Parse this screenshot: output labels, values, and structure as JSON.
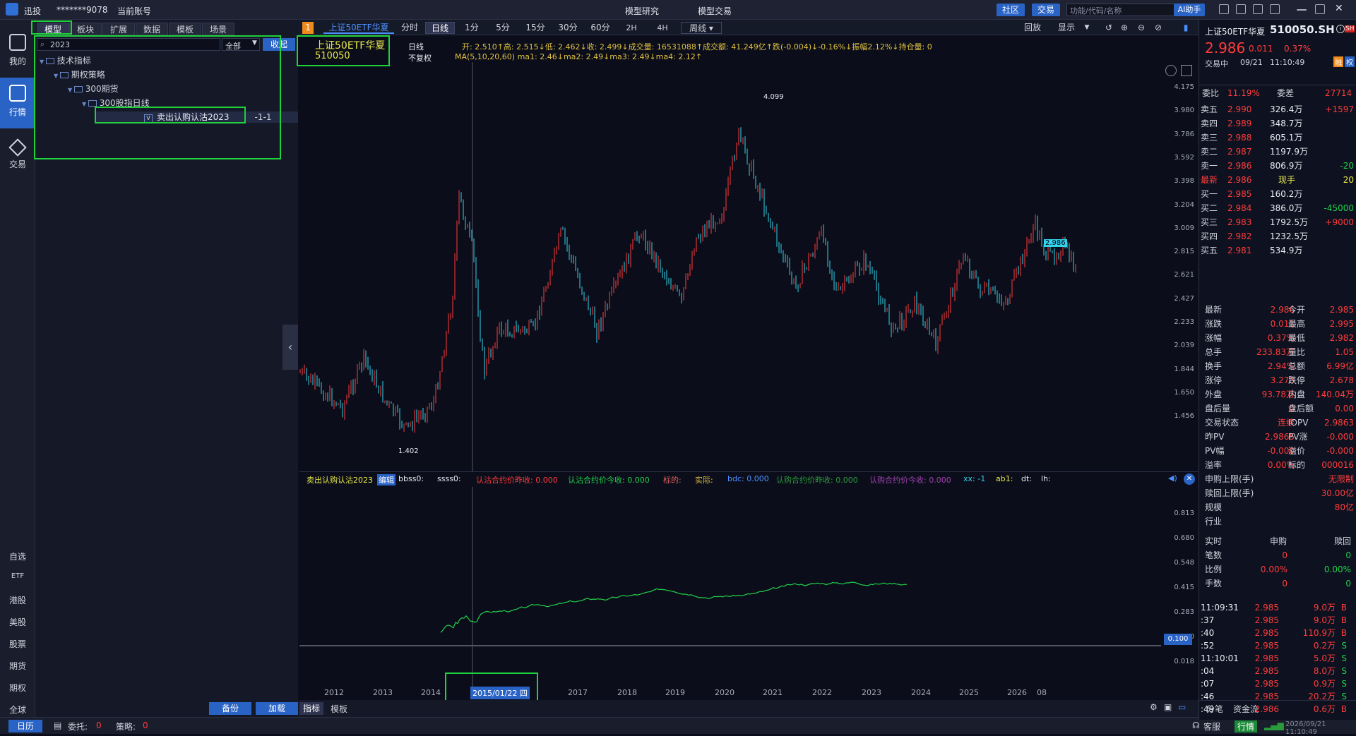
{
  "titlebar": {
    "app": "迅投",
    "account": "*******9078",
    "account_label": "当前账号",
    "model_research": "模型研究",
    "model_trade": "模型交易",
    "community": "社区",
    "trade": "交易",
    "search_placeholder": "功能/代码/名称",
    "ai": "AI助手"
  },
  "leftbar": {
    "items": [
      "我的",
      "行情",
      "交易"
    ],
    "bottom": [
      "自选",
      "ETF",
      "港股",
      "美股",
      "股票",
      "期货",
      "期权",
      "全球"
    ]
  },
  "tree": {
    "tabs": [
      "模型",
      "板块",
      "扩展",
      "数据",
      "模板",
      "场景"
    ],
    "filter_value": "2023",
    "filter_select": "全部",
    "collapse": "收起",
    "rows": [
      "技术指标",
      "期权策略",
      "300期货",
      "300股指日线"
    ],
    "selected": "卖出认购认沽2023",
    "selected_tag": "-1-1"
  },
  "chart_header": {
    "tab_num": "1",
    "tab_name": "上证50ETF华夏",
    "periods": [
      "分时",
      "日线",
      "1分",
      "5分",
      "15分",
      "30分",
      "60分",
      "2H",
      "4H",
      "周线"
    ],
    "active_period": "日线",
    "replay": "回放",
    "display": "显示"
  },
  "stock_box": {
    "name": "上证50ETF华夏",
    "code": "510050"
  },
  "infobar": {
    "line1_label": "日线",
    "line2_label": "不复权",
    "ohlc": "开: 2.510↑高: 2.515↓低: 2.462↓收: 2.499↓成交量: 16531088↑成交额: 41.249亿↑跌(-0.004)↓-0.16%↓振幅2.12%↓持仓量: 0",
    "ma": "MA(5,10,20,60)   ma1: 2.46↓ma2: 2.49↓ma3: 2.49↓ma4: 2.12↑"
  },
  "main_axis": [
    "4.175",
    "3.980",
    "3.786",
    "3.592",
    "3.398",
    "3.204",
    "3.009",
    "2.815",
    "2.621",
    "2.427",
    "2.233",
    "2.039",
    "1.844",
    "1.650",
    "1.456"
  ],
  "main_annot": {
    "high": "4.099",
    "low": "1.402",
    "last": "2.986"
  },
  "sub_header": {
    "name": "卖出认购认沽2023",
    "edit": "编辑",
    "fields": [
      "bbss0:",
      "ssss0:",
      "认沽合约价昨收: 0.000",
      "认沽合约价今收: 0.000",
      "标的:",
      "实际:",
      "bdc: 0.000",
      "认购合约价昨收: 0.000",
      "认购合约价今收: 0.000",
      "xx: -1",
      "ab1:",
      "dt:",
      "lh:"
    ]
  },
  "sub_axis": [
    "0.813",
    "0.680",
    "0.548",
    "0.415",
    "0.283",
    "0.150",
    "0.018"
  ],
  "sub_cursor": "0.100",
  "xaxis": {
    "years": [
      "2012",
      "2013",
      "2014",
      "2015/01/22 四",
      "2017",
      "2018",
      "2019",
      "2020",
      "2021",
      "2022",
      "2023",
      "2024",
      "2025",
      "2026",
      "08"
    ]
  },
  "bottom_tools": {
    "backup": "备份",
    "load": "加载",
    "indicator": "指标",
    "template": "模板"
  },
  "bottombar": {
    "calendar": "日历",
    "entrust": "委托:",
    "entrust_v": "0",
    "strategy": "策略:",
    "strategy_v": "0",
    "service": "客服",
    "quote": "行情",
    "time": "2026/09/21 11:10:49"
  },
  "right": {
    "title": "上证50ETF华夏",
    "code": "510050.SH",
    "price": "2.986",
    "chg": "0.011",
    "pct": "0.37%",
    "status": "交易中",
    "date": "09/21",
    "time": "11:10:49",
    "weibi": "11.19%",
    "weicha": "27714",
    "asks": [
      [
        "卖五",
        "2.990",
        "326.4万",
        "+1597"
      ],
      [
        "卖四",
        "2.989",
        "348.7万",
        ""
      ],
      [
        "卖三",
        "2.988",
        "605.1万",
        ""
      ],
      [
        "卖二",
        "2.987",
        "1197.9万",
        ""
      ],
      [
        "卖一",
        "2.986",
        "806.9万",
        "-20"
      ]
    ],
    "last": [
      "最新",
      "2.986",
      "现手",
      "20"
    ],
    "bids": [
      [
        "买一",
        "2.985",
        "160.2万",
        ""
      ],
      [
        "买二",
        "2.984",
        "386.0万",
        "-45000"
      ],
      [
        "买三",
        "2.983",
        "1792.5万",
        "+9000"
      ],
      [
        "买四",
        "2.982",
        "1232.5万",
        ""
      ],
      [
        "买五",
        "2.981",
        "534.9万",
        ""
      ]
    ],
    "stats": [
      [
        "最新",
        "2.986",
        "今开",
        "2.985"
      ],
      [
        "涨跌",
        "0.011",
        "最高",
        "2.995"
      ],
      [
        "涨幅",
        "0.37%",
        "最低",
        "2.982"
      ],
      [
        "总手",
        "233.83万",
        "量比",
        "1.05"
      ],
      [
        "换手",
        "2.94%",
        "总额",
        "6.99亿"
      ],
      [
        "涨停",
        "3.273",
        "跌停",
        "2.678"
      ],
      [
        "外盘",
        "93.78万",
        "内盘",
        "140.04万"
      ],
      [
        "盘后量",
        "0",
        "盘后额",
        "0.00"
      ],
      [
        "交易状态",
        "连续",
        "IOPV",
        "2.9863"
      ],
      [
        "昨PV",
        "2.9865",
        "PV涨",
        "-0.000"
      ],
      [
        "PV幅",
        "-0.000",
        "溢价",
        "-0.000"
      ],
      [
        "溢率",
        "0.00%",
        "标的",
        "000016"
      ],
      [
        "申购上限(手)",
        "",
        "",
        "无限制"
      ],
      [
        "赎回上限(手)",
        "",
        "",
        "30.00亿"
      ],
      [
        "规模",
        "",
        "",
        "80亿"
      ],
      [
        "行业",
        "",
        "",
        ""
      ]
    ],
    "sub_table": {
      "headers": [
        "实时",
        "申购",
        "赎回"
      ],
      "rows": [
        [
          "笔数",
          "0",
          "0"
        ],
        [
          "比例",
          "0.00%",
          "0.00%"
        ],
        [
          "手数",
          "0",
          "0"
        ]
      ]
    },
    "ticks": [
      [
        "11:09:31",
        "2.985",
        "9.0万",
        "B"
      ],
      [
        ":37",
        "2.985",
        "9.0万",
        "B"
      ],
      [
        ":40",
        "2.985",
        "110.9万",
        "B"
      ],
      [
        ":52",
        "2.985",
        "0.2万",
        "S"
      ],
      [
        "11:10:01",
        "2.985",
        "5.0万",
        "S"
      ],
      [
        ":04",
        "2.985",
        "8.0万",
        "S"
      ],
      [
        ":07",
        "2.985",
        "0.9万",
        "S"
      ],
      [
        ":46",
        "2.985",
        "20.2万",
        "S"
      ],
      [
        ":49",
        "2.986",
        "0.6万",
        "B"
      ]
    ],
    "tabs": [
      "分笔",
      "资金流"
    ]
  }
}
